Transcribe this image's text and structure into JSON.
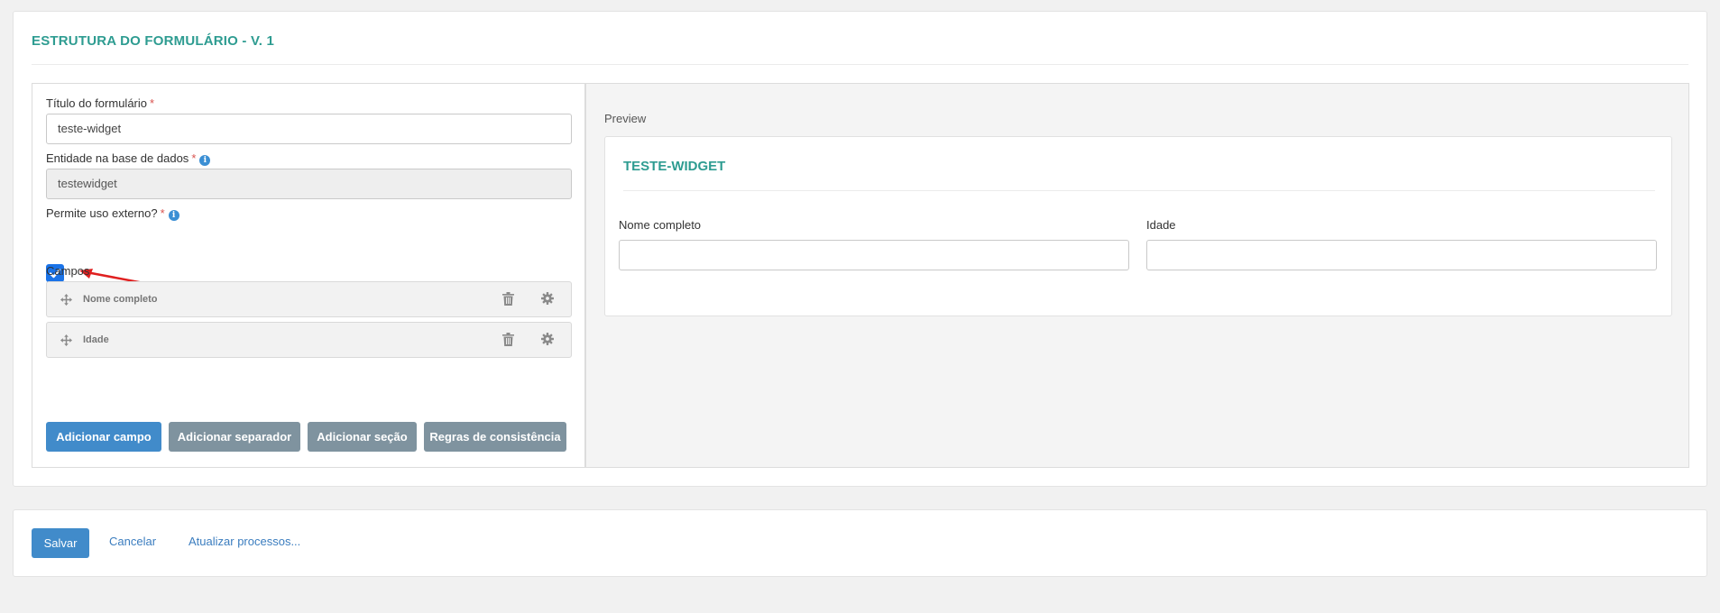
{
  "structure": {
    "title": "ESTRUTURA DO FORMULÁRIO - V. 1"
  },
  "editor": {
    "form_title_label": "Título do formulário",
    "form_title_value": "teste-widget",
    "entity_label": "Entidade na base de dados",
    "entity_value": "testewidget",
    "external_use_label": "Permite uso externo?",
    "external_use_checked": true,
    "required_mark": "*",
    "info_glyph": "i",
    "fields_label": "Campos",
    "fields": [
      {
        "name": "Nome completo"
      },
      {
        "name": "Idade"
      }
    ],
    "buttons": {
      "add_field": "Adicionar campo",
      "add_separator": "Adicionar separador",
      "add_section": "Adicionar seção",
      "consistency_rules": "Regras de consistência"
    }
  },
  "preview": {
    "label": "Preview",
    "form_title": "TESTE-WIDGET",
    "fields": [
      {
        "label": "Nome completo"
      },
      {
        "label": "Idade"
      }
    ]
  },
  "footer": {
    "save": "Salvar",
    "cancel": "Cancelar",
    "update_processes": "Atualizar processos..."
  },
  "colors": {
    "accent_teal": "#2e9c91",
    "primary_blue": "#418bca",
    "grey_button": "#7f939f",
    "link_blue": "#3b7dbf",
    "required_red": "#d9534f",
    "annotation_red": "#e02020"
  }
}
